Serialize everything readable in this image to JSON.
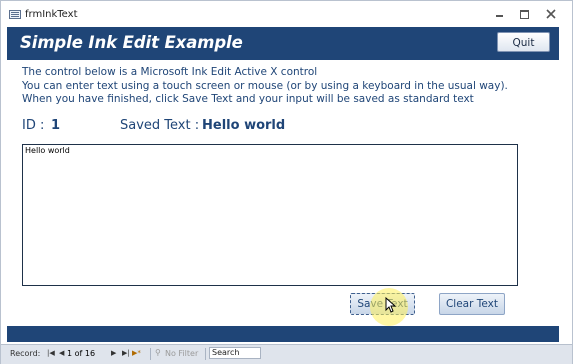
{
  "window": {
    "title": "frmInkText"
  },
  "header": {
    "title": "Simple Ink Edit Example",
    "quit_label": "Quit"
  },
  "intro": {
    "line1": "The control below is a Microsoft Ink Edit Active X control",
    "line2": "You can enter text using a touch screen or mouse (or by using a keyboard in the usual way).",
    "line3": "When you have finished, click Save Text and your input will be saved as standard text"
  },
  "record": {
    "id_label": "ID :",
    "id_value": "1",
    "saved_label": "Saved Text :",
    "saved_value": "Hello world"
  },
  "ink": {
    "content": "Hello world"
  },
  "buttons": {
    "save_label": "Save Text",
    "clear_label": "Clear Text"
  },
  "navbar": {
    "record_label": "Record:",
    "position": "1 of 16",
    "filter_label": "No Filter",
    "search_placeholder": "Search"
  },
  "colors": {
    "brand": "#1f4577",
    "text_accent": "#1f4577",
    "highlight": "#fff05a"
  },
  "icons": {
    "window": "form-icon",
    "first": "first-record-icon",
    "prev": "previous-record-icon",
    "next": "next-record-icon",
    "last": "last-record-icon",
    "new": "new-record-icon",
    "filter": "filter-icon"
  }
}
